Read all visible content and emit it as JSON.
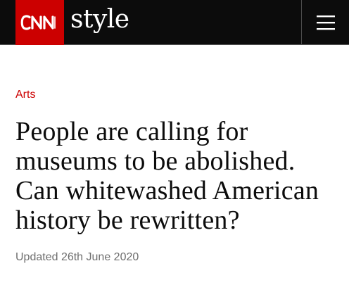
{
  "header": {
    "logo_text": "CNN",
    "section_brand": "style",
    "brand_color": "#cc0000",
    "bar_color": "#0c0c0c",
    "menu_icon": "hamburger-menu-icon"
  },
  "article": {
    "section": "Arts",
    "headline": "People are calling for museums to be abolished. Can whitewashed American history be rewritten?",
    "updated": "Updated 26th June 2020"
  }
}
